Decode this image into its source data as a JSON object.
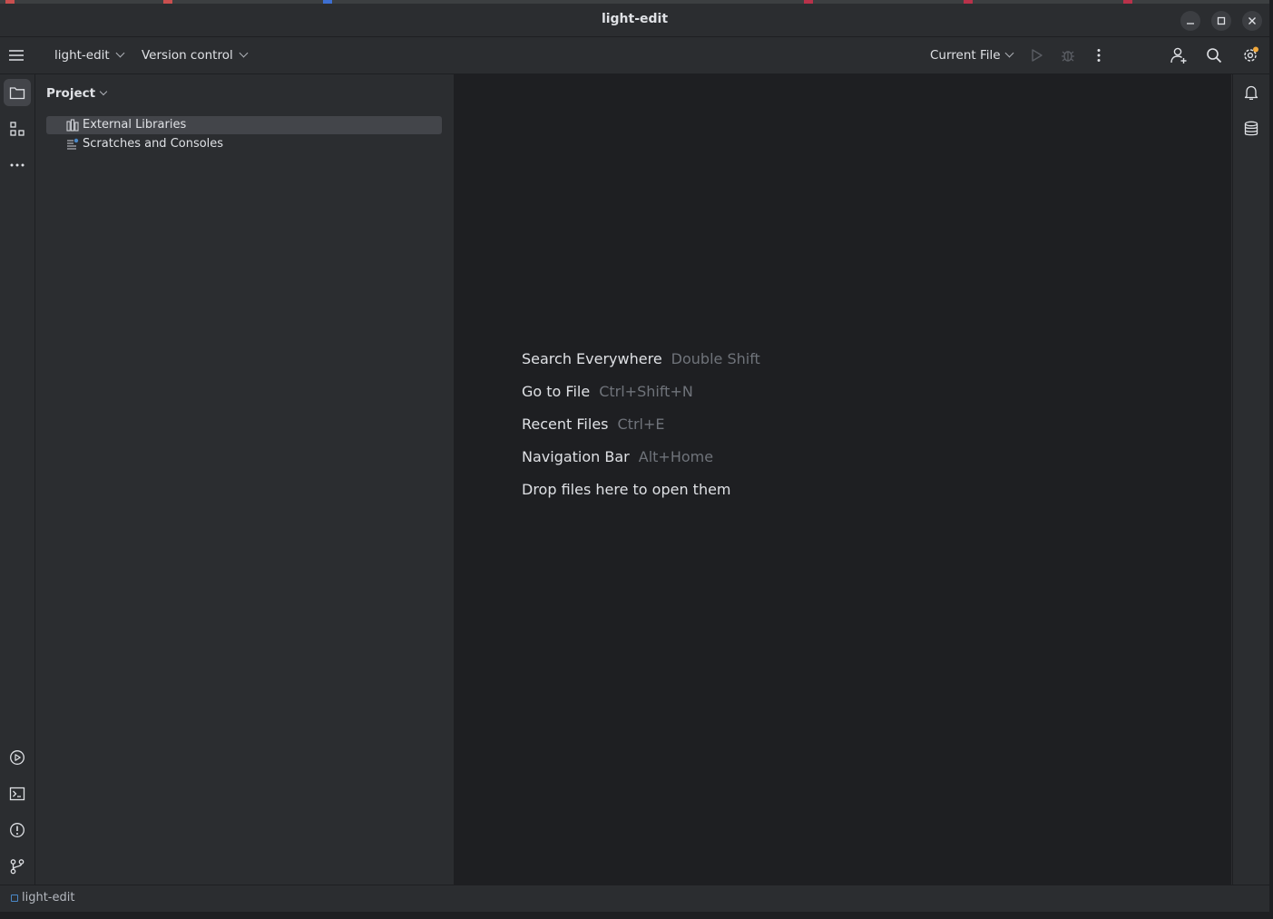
{
  "window": {
    "title": "light-edit"
  },
  "toolbar": {
    "project_name": "light-edit",
    "vcs_label": "Version control",
    "run_config": "Current File"
  },
  "project_panel": {
    "title": "Project",
    "items": [
      {
        "label": "External Libraries",
        "icon": "library-icon",
        "selected": true
      },
      {
        "label": "Scratches and Consoles",
        "icon": "scratches-icon",
        "selected": false
      }
    ]
  },
  "editor": {
    "hints": [
      {
        "action": "Search Everywhere",
        "shortcut": "Double Shift"
      },
      {
        "action": "Go to File",
        "shortcut": "Ctrl+Shift+N"
      },
      {
        "action": "Recent Files",
        "shortcut": "Ctrl+E"
      },
      {
        "action": "Navigation Bar",
        "shortcut": "Alt+Home"
      },
      {
        "action": "Drop files here to open them",
        "shortcut": ""
      }
    ]
  },
  "statusbar": {
    "breadcrumb": "light-edit"
  },
  "colors": {
    "accent": "#4a88c7",
    "notification_dot": "#f2a93b",
    "selection": "#43454a"
  }
}
